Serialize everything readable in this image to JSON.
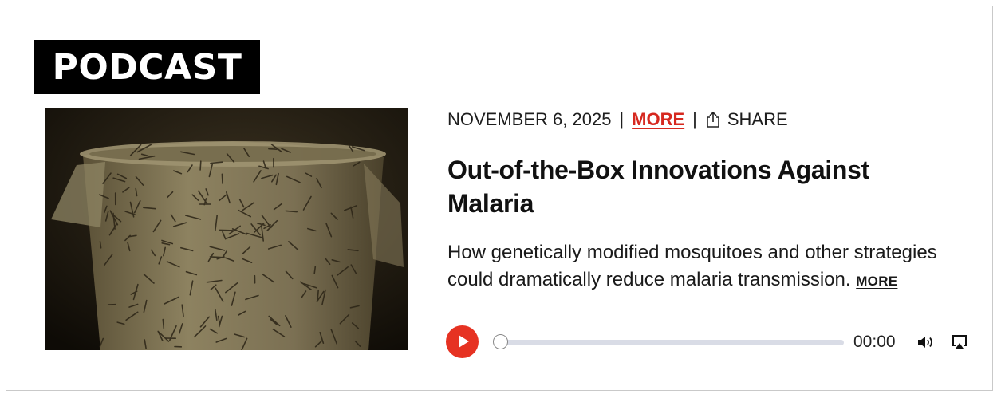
{
  "badge": {
    "label": "PODCAST"
  },
  "image": {
    "alt": "Mosquitoes inside a covered plastic bucket"
  },
  "meta": {
    "date": "NOVEMBER 6, 2025",
    "separator": "|",
    "more_label": "MORE",
    "share_label": "SHARE",
    "more_color": "#d6281f"
  },
  "episode": {
    "title": "Out-of-the-Box Innovations Against Malaria",
    "description": "How genetically modified mosquitoes and other strategies could dramatically reduce malaria transmission.",
    "more_label": "MORE"
  },
  "player": {
    "time": "00:00",
    "progress": 0,
    "play_icon": "play-icon",
    "volume_icon": "volume-icon",
    "cast_icon": "airplay-icon",
    "accent": "#e63222"
  }
}
